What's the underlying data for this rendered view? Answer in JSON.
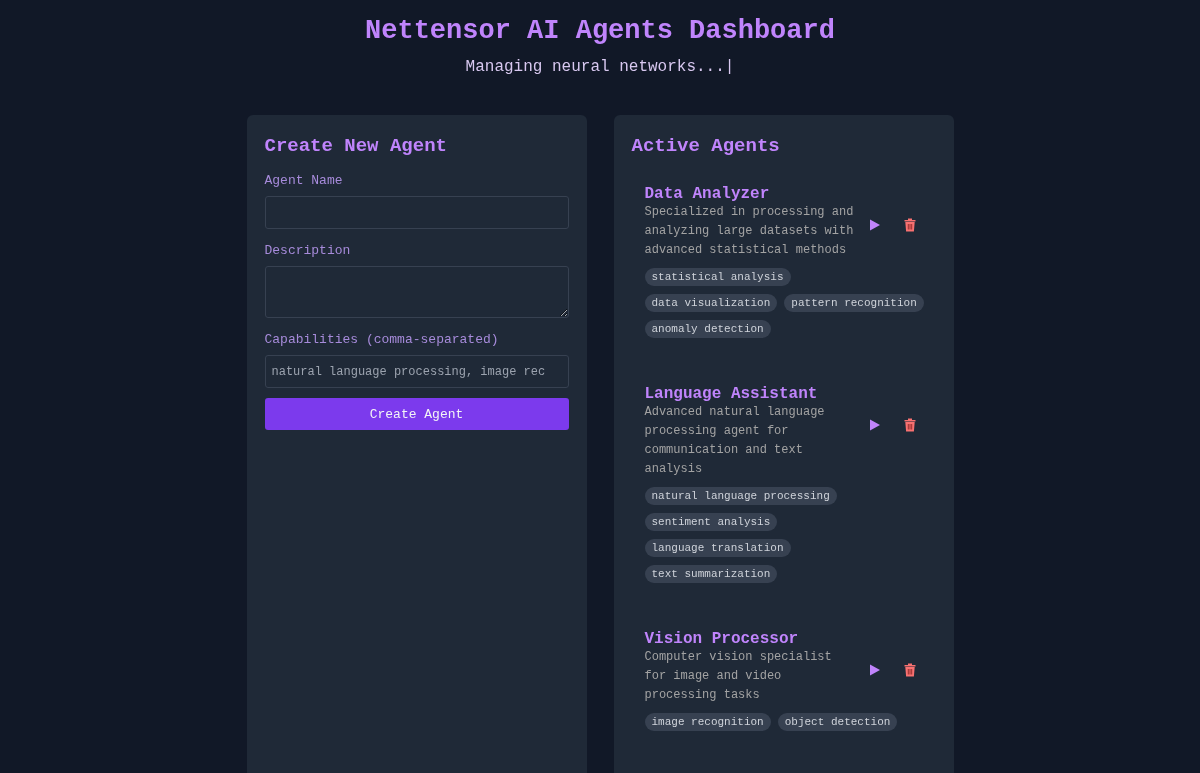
{
  "header": {
    "title": "Nettensor AI Agents Dashboard",
    "subtitle": "Managing neural networks...|"
  },
  "create_panel": {
    "title": "Create New Agent",
    "fields": [
      {
        "kind": "input",
        "label": "Agent Name"
      },
      {
        "kind": "textarea",
        "label": "Description"
      },
      {
        "kind": "input",
        "label": "Capabilities (comma-separated)",
        "placeholder": "natural language processing, image rec"
      }
    ],
    "button": "Create Agent"
  },
  "agents_panel": {
    "title": "Active Agents",
    "agents": [
      {
        "name": "Data Analyzer",
        "description": "Specialized in processing and analyzing large datasets with advanced statistical methods",
        "capabilities": [
          "statistical analysis",
          "data visualization",
          "pattern recognition",
          "anomaly detection"
        ]
      },
      {
        "name": "Language Assistant",
        "description": "Advanced natural language processing agent for communication and text analysis",
        "capabilities": [
          "natural language processing",
          "sentiment analysis",
          "language translation",
          "text summarization"
        ]
      },
      {
        "name": "Vision Processor",
        "description": "Computer vision specialist for image and video processing tasks",
        "capabilities": [
          "image recognition",
          "object detection"
        ]
      }
    ]
  }
}
